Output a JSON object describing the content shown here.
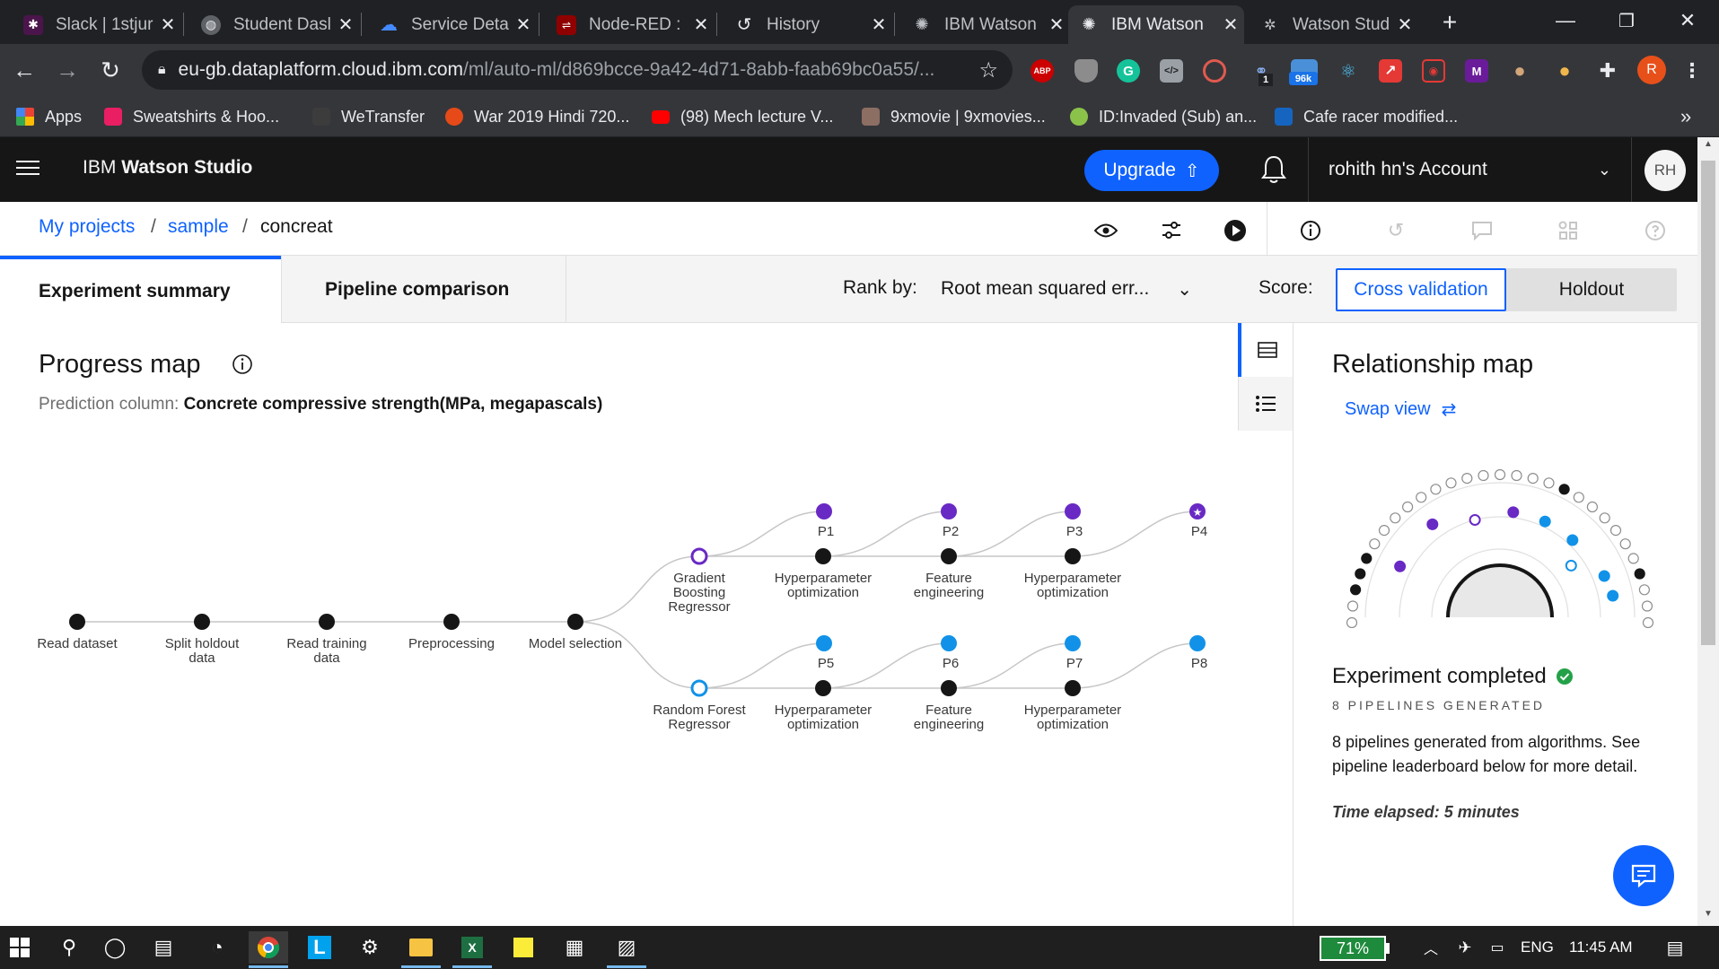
{
  "browser": {
    "tabs": [
      {
        "title": "Slack | 1stjur"
      },
      {
        "title": "Student Dasl"
      },
      {
        "title": "Service Deta"
      },
      {
        "title": "Node-RED :"
      },
      {
        "title": "History"
      },
      {
        "title": "IBM Watson"
      },
      {
        "title": "IBM Watson"
      },
      {
        "title": "Watson Stud"
      }
    ],
    "url_domain": "eu-gb.dataplatform.cloud.ibm.com",
    "url_path": "/ml/auto-ml/d869bcce-9a42-4d71-8abb-faab69bc0a55/...",
    "ext_labels": {
      "abp": "ABP",
      "badge_one": "1",
      "badge_96k": "96k",
      "profile": "R"
    },
    "bookmarks": [
      {
        "label": "Apps",
        "color": "#ea4335"
      },
      {
        "label": "Sweatshirts & Hoo...",
        "color": "#e91e63"
      },
      {
        "label": "WeTransfer",
        "color": "#3c3c3c"
      },
      {
        "label": "War 2019 Hindi 720...",
        "color": "#e64a19"
      },
      {
        "label": "(98) Mech lecture V...",
        "color": "#ff0000"
      },
      {
        "label": "9xmovie | 9xmovies...",
        "color": "#8d6e63"
      },
      {
        "label": "ID:Invaded (Sub) an...",
        "color": "#8bc34a"
      },
      {
        "label": "Cafe racer modified...",
        "color": "#1565c0"
      }
    ],
    "overflow": "»"
  },
  "app": {
    "brand_prefix": "IBM",
    "brand_name": "Watson Studio",
    "upgrade_label": "Upgrade",
    "account_label": "rohith hn's Account",
    "avatar_initials": "RH"
  },
  "breadcrumb": {
    "items": [
      "My projects",
      "sample",
      "concreat"
    ],
    "separator": "/"
  },
  "tabs": {
    "summary": "Experiment summary",
    "comparison": "Pipeline comparison"
  },
  "rank": {
    "label": "Rank by:",
    "value": "Root mean squared err..."
  },
  "score": {
    "label": "Score:",
    "options": [
      "Cross validation",
      "Holdout"
    ],
    "selected": "Cross validation"
  },
  "progress": {
    "title": "Progress map",
    "prediction_label": "Prediction column:",
    "prediction_value": "Concrete compressive strength(MPa, megapascals)",
    "stages": [
      "Read dataset",
      "Split holdout data",
      "Read training data",
      "Preprocessing",
      "Model selection"
    ],
    "algorithms": [
      "Gradient Boosting Regressor",
      "Random Forest Regressor"
    ],
    "steps": [
      "Hyperparameter optimization",
      "Feature engineering",
      "Hyperparameter optimization"
    ],
    "pipelines_top": [
      "P1",
      "P2",
      "P3",
      "P4"
    ],
    "pipelines_bottom": [
      "P5",
      "P6",
      "P7",
      "P8"
    ],
    "colors": {
      "gbr": "#6929c4",
      "rfr": "#1192e8",
      "node": "#161616",
      "line": "#c6c6c6"
    }
  },
  "relationship": {
    "title": "Relationship map",
    "swap_label": "Swap view",
    "status_title": "Experiment completed",
    "pipelines_generated": "8 PIPELINES GENERATED",
    "description": "8 pipelines generated from algorithms. See pipeline leaderboard below for more detail.",
    "time_elapsed": "Time elapsed: 5 minutes"
  },
  "taskbar": {
    "battery": "71%",
    "language": "ENG",
    "time": "11:45 AM"
  }
}
